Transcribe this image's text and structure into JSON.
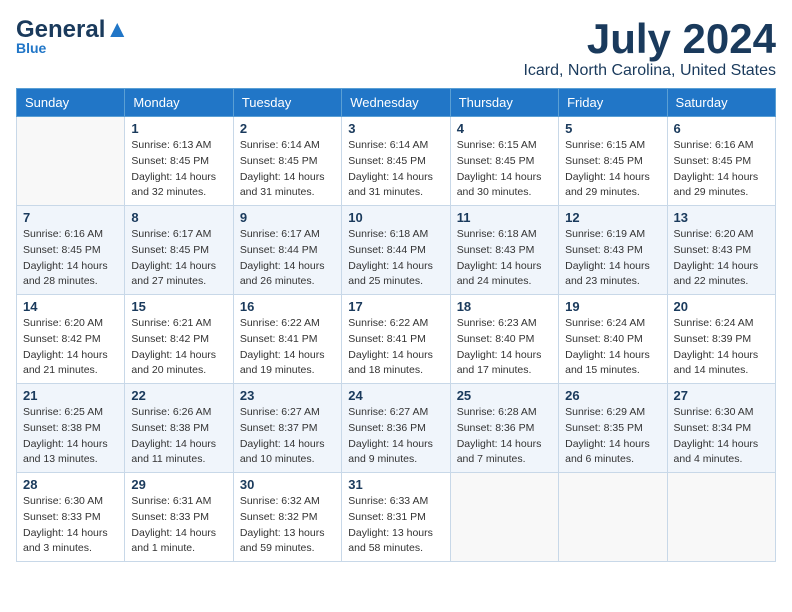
{
  "header": {
    "logo_general": "General",
    "logo_blue": "Blue",
    "month_title": "July 2024",
    "location": "Icard, North Carolina, United States"
  },
  "weekdays": [
    "Sunday",
    "Monday",
    "Tuesday",
    "Wednesday",
    "Thursday",
    "Friday",
    "Saturday"
  ],
  "weeks": [
    [
      {
        "day": "",
        "info": ""
      },
      {
        "day": "1",
        "info": "Sunrise: 6:13 AM\nSunset: 8:45 PM\nDaylight: 14 hours\nand 32 minutes."
      },
      {
        "day": "2",
        "info": "Sunrise: 6:14 AM\nSunset: 8:45 PM\nDaylight: 14 hours\nand 31 minutes."
      },
      {
        "day": "3",
        "info": "Sunrise: 6:14 AM\nSunset: 8:45 PM\nDaylight: 14 hours\nand 31 minutes."
      },
      {
        "day": "4",
        "info": "Sunrise: 6:15 AM\nSunset: 8:45 PM\nDaylight: 14 hours\nand 30 minutes."
      },
      {
        "day": "5",
        "info": "Sunrise: 6:15 AM\nSunset: 8:45 PM\nDaylight: 14 hours\nand 29 minutes."
      },
      {
        "day": "6",
        "info": "Sunrise: 6:16 AM\nSunset: 8:45 PM\nDaylight: 14 hours\nand 29 minutes."
      }
    ],
    [
      {
        "day": "7",
        "info": "Sunrise: 6:16 AM\nSunset: 8:45 PM\nDaylight: 14 hours\nand 28 minutes."
      },
      {
        "day": "8",
        "info": "Sunrise: 6:17 AM\nSunset: 8:45 PM\nDaylight: 14 hours\nand 27 minutes."
      },
      {
        "day": "9",
        "info": "Sunrise: 6:17 AM\nSunset: 8:44 PM\nDaylight: 14 hours\nand 26 minutes."
      },
      {
        "day": "10",
        "info": "Sunrise: 6:18 AM\nSunset: 8:44 PM\nDaylight: 14 hours\nand 25 minutes."
      },
      {
        "day": "11",
        "info": "Sunrise: 6:18 AM\nSunset: 8:43 PM\nDaylight: 14 hours\nand 24 minutes."
      },
      {
        "day": "12",
        "info": "Sunrise: 6:19 AM\nSunset: 8:43 PM\nDaylight: 14 hours\nand 23 minutes."
      },
      {
        "day": "13",
        "info": "Sunrise: 6:20 AM\nSunset: 8:43 PM\nDaylight: 14 hours\nand 22 minutes."
      }
    ],
    [
      {
        "day": "14",
        "info": "Sunrise: 6:20 AM\nSunset: 8:42 PM\nDaylight: 14 hours\nand 21 minutes."
      },
      {
        "day": "15",
        "info": "Sunrise: 6:21 AM\nSunset: 8:42 PM\nDaylight: 14 hours\nand 20 minutes."
      },
      {
        "day": "16",
        "info": "Sunrise: 6:22 AM\nSunset: 8:41 PM\nDaylight: 14 hours\nand 19 minutes."
      },
      {
        "day": "17",
        "info": "Sunrise: 6:22 AM\nSunset: 8:41 PM\nDaylight: 14 hours\nand 18 minutes."
      },
      {
        "day": "18",
        "info": "Sunrise: 6:23 AM\nSunset: 8:40 PM\nDaylight: 14 hours\nand 17 minutes."
      },
      {
        "day": "19",
        "info": "Sunrise: 6:24 AM\nSunset: 8:40 PM\nDaylight: 14 hours\nand 15 minutes."
      },
      {
        "day": "20",
        "info": "Sunrise: 6:24 AM\nSunset: 8:39 PM\nDaylight: 14 hours\nand 14 minutes."
      }
    ],
    [
      {
        "day": "21",
        "info": "Sunrise: 6:25 AM\nSunset: 8:38 PM\nDaylight: 14 hours\nand 13 minutes."
      },
      {
        "day": "22",
        "info": "Sunrise: 6:26 AM\nSunset: 8:38 PM\nDaylight: 14 hours\nand 11 minutes."
      },
      {
        "day": "23",
        "info": "Sunrise: 6:27 AM\nSunset: 8:37 PM\nDaylight: 14 hours\nand 10 minutes."
      },
      {
        "day": "24",
        "info": "Sunrise: 6:27 AM\nSunset: 8:36 PM\nDaylight: 14 hours\nand 9 minutes."
      },
      {
        "day": "25",
        "info": "Sunrise: 6:28 AM\nSunset: 8:36 PM\nDaylight: 14 hours\nand 7 minutes."
      },
      {
        "day": "26",
        "info": "Sunrise: 6:29 AM\nSunset: 8:35 PM\nDaylight: 14 hours\nand 6 minutes."
      },
      {
        "day": "27",
        "info": "Sunrise: 6:30 AM\nSunset: 8:34 PM\nDaylight: 14 hours\nand 4 minutes."
      }
    ],
    [
      {
        "day": "28",
        "info": "Sunrise: 6:30 AM\nSunset: 8:33 PM\nDaylight: 14 hours\nand 3 minutes."
      },
      {
        "day": "29",
        "info": "Sunrise: 6:31 AM\nSunset: 8:33 PM\nDaylight: 14 hours\nand 1 minute."
      },
      {
        "day": "30",
        "info": "Sunrise: 6:32 AM\nSunset: 8:32 PM\nDaylight: 13 hours\nand 59 minutes."
      },
      {
        "day": "31",
        "info": "Sunrise: 6:33 AM\nSunset: 8:31 PM\nDaylight: 13 hours\nand 58 minutes."
      },
      {
        "day": "",
        "info": ""
      },
      {
        "day": "",
        "info": ""
      },
      {
        "day": "",
        "info": ""
      }
    ]
  ]
}
